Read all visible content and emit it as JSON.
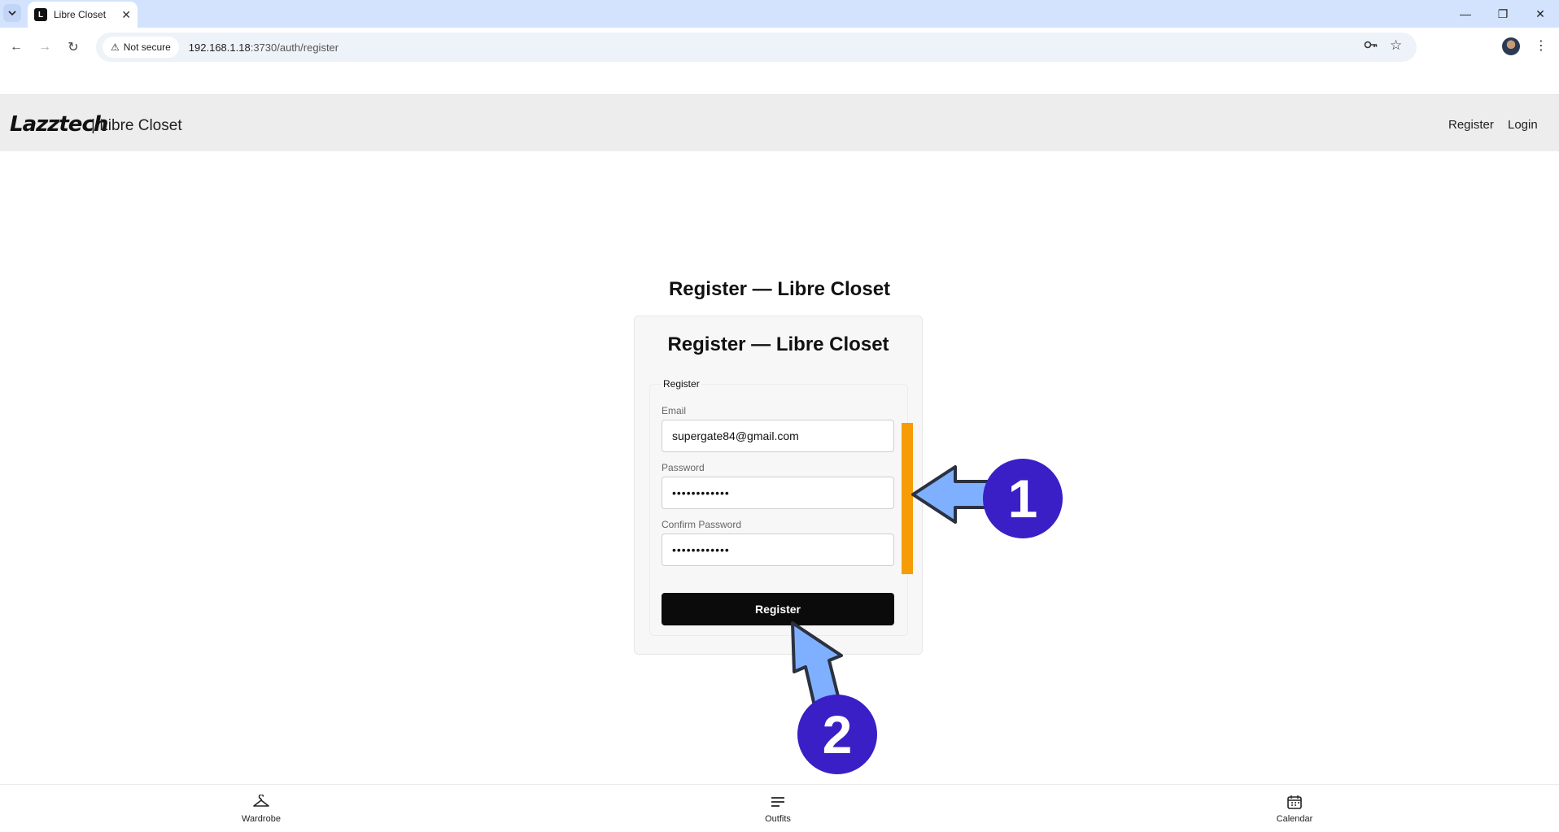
{
  "browser": {
    "tab_title": "Libre Closet",
    "security_label": "Not secure",
    "url_host": "192.168.1.18",
    "url_path": ":3730/auth/register"
  },
  "header": {
    "logo": "Lazztech",
    "separator_title": "| Libre Closet",
    "nav": {
      "register": "Register",
      "login": "Login"
    }
  },
  "main": {
    "page_heading": "Register — Libre Closet",
    "card_heading": "Register — Libre Closet",
    "form": {
      "legend": "Register",
      "email_label": "Email",
      "email_value": "supergate84@gmail.com",
      "password_label": "Password",
      "password_value": "••••••••••••",
      "confirm_label": "Confirm Password",
      "confirm_value": "••••••••••••",
      "submit_label": "Register"
    }
  },
  "annotations": {
    "step1": "1",
    "step2": "2",
    "arrow_color": "#7fb0ff",
    "badge_color": "#3a1fc6",
    "highlight_color": "#f59c07"
  },
  "bottom_nav": {
    "items": [
      {
        "label": "Wardrobe",
        "icon": "hanger-icon"
      },
      {
        "label": "Outfits",
        "icon": "list-icon"
      },
      {
        "label": "Calendar",
        "icon": "calendar-icon"
      }
    ]
  }
}
